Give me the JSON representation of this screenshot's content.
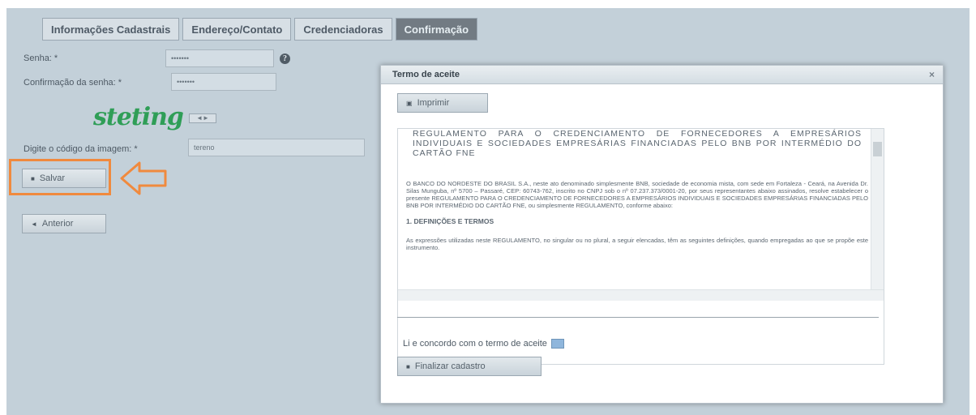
{
  "tabs": [
    {
      "label": "Informações Cadastrais"
    },
    {
      "label": "Endereço/Contato"
    },
    {
      "label": "Credenciadoras"
    },
    {
      "label": "Confirmação"
    }
  ],
  "form": {
    "senha_label": "Senha: *",
    "senha_value": "•••••••",
    "confirmacao_label": "Confirmação da senha: *",
    "confirmacao_value": "•••••••",
    "captcha_text": "steting",
    "codigo_label": "Digite o código da imagem: *",
    "codigo_value": "tereno",
    "salvar_label": "Salvar",
    "anterior_label": "Anterior"
  },
  "modal": {
    "title": "Termo de aceite",
    "close": "×",
    "imprimir_label": "Imprimir",
    "doc_title": "REGULAMENTO PARA O CREDENCIAMENTO DE FORNECEDORES A EMPRESÁRIOS INDIVIDUAIS E SOCIEDADES EMPRESÁRIAS FINANCIADAS PELO BNB POR INTERMÉDIO DO CARTÃO FNE",
    "doc_paragraph": "O BANCO DO NORDESTE DO BRASIL S.A., neste ato denominado simplesmente BNB, sociedade de economia mista, com sede em Fortaleza - Ceará, na Avenida Dr. Silas Munguba, nº 5700 – Passaré, CEP: 60743-762, inscrito no CNPJ sob o nº 07.237.373/0001-20, por seus representantes abaixo assinados, resolve estabelecer o presente REGULAMENTO PARA O CREDENCIAMENTO DE FORNECEDORES A EMPRESÁRIOS INDIVIDUAIS E SOCIEDADES EMPRESÁRIAS FINANCIADAS PELO BNB POR INTERMÉDIO DO CARTÃO FNE, ou simplesmente REGULAMENTO, conforme abaixo:",
    "section_heading": "1.   DEFINIÇÕES E TERMOS",
    "section_paragraph": "As expressões utilizadas neste REGULAMENTO, no singular ou no plural, a seguir elencadas, têm as seguintes definições, quando empregadas ao que se propõe este instrumento.",
    "agree_label": "Li e concordo com o termo de aceite",
    "finalizar_label": "Finalizar cadastro"
  }
}
